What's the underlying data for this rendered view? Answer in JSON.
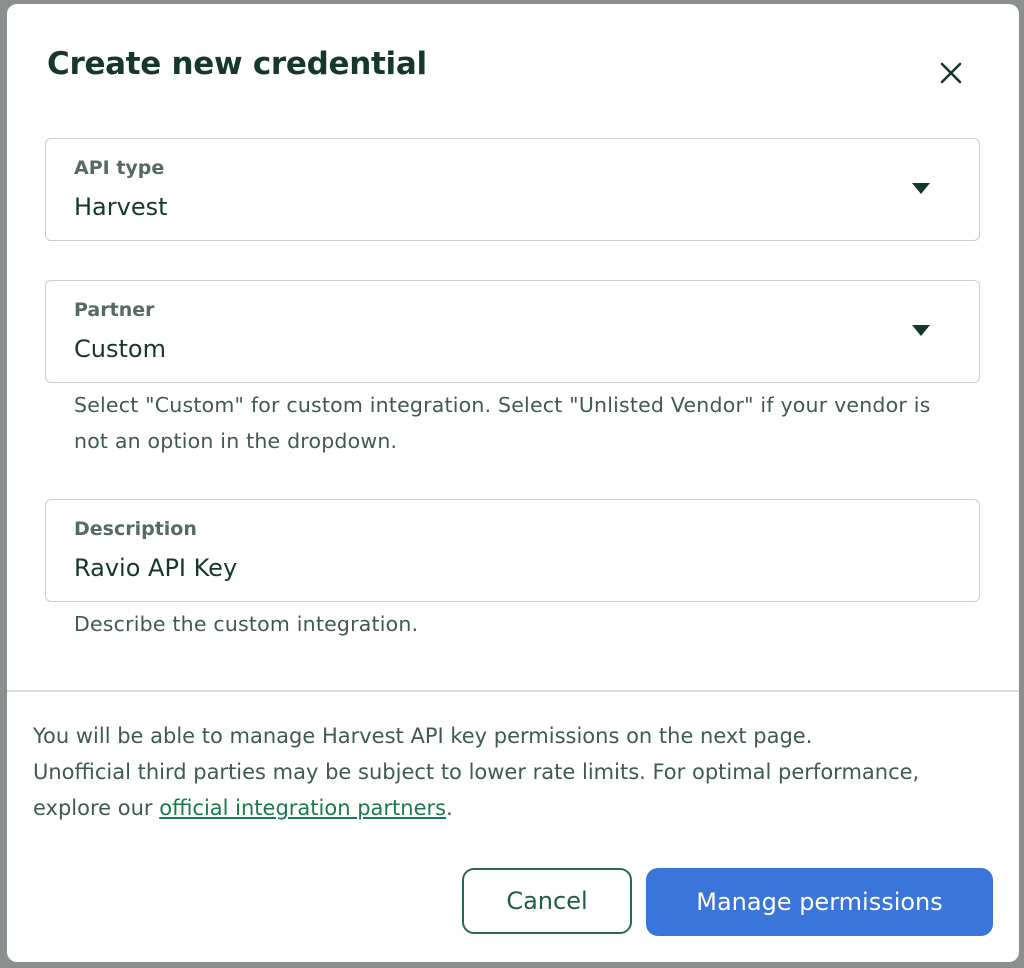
{
  "dialog": {
    "title": "Create new credential",
    "close_icon": "close-icon"
  },
  "fields": {
    "api_type": {
      "label": "API type",
      "value": "Harvest",
      "icon": "caret-down-icon"
    },
    "partner": {
      "label": "Partner",
      "value": "Custom",
      "icon": "caret-down-icon",
      "helper": "Select \"Custom\" for custom integration. Select \"Unlisted Vendor\" if your vendor is not an option in the dropdown."
    },
    "description": {
      "label": "Description",
      "value": "Ravio API Key",
      "helper": "Describe the custom integration."
    }
  },
  "notice": {
    "line1": "You will be able to manage Harvest API key permissions on the next page.",
    "line2": "Unofficial third parties may be subject to lower rate limits. For optimal performance, explore our",
    "link_text": "official integration partners",
    "suffix": "."
  },
  "buttons": {
    "cancel": "Cancel",
    "primary": "Manage permissions"
  },
  "colors": {
    "title": "#15372c",
    "primary_button": "#3a76d9",
    "cancel_border": "#2a6a50",
    "link": "#1b7a4b"
  }
}
